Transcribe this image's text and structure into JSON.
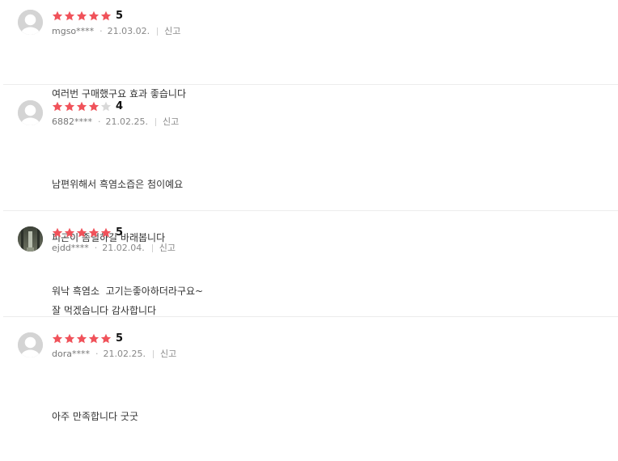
{
  "colors": {
    "star_filled": "#f0525a",
    "star_empty": "#d9d9d9",
    "meta_text": "#888888",
    "divider": "#ececec"
  },
  "reviews": [
    {
      "avatar": "default-avatar-icon",
      "rating": 5,
      "score_label": "5",
      "user": "mgso****",
      "date": "21.03.02.",
      "report_label": "신고",
      "lines": [
        "여러번 구매했구요 효과 좋습니다"
      ]
    },
    {
      "avatar": "default-avatar-icon",
      "rating": 4,
      "score_label": "4",
      "user": "6882****",
      "date": "21.02.25.",
      "report_label": "신고",
      "lines": [
        "남편위해서 흑염소즙은 첨이예요",
        "피곤이 좀덜하길 바래봅니다",
        "워낙 흑염소  고기는좋아하더라구요~"
      ]
    },
    {
      "avatar": "profile-photo",
      "rating": 5,
      "score_label": "5",
      "user": "ejdd****",
      "date": "21.02.04.",
      "report_label": "신고",
      "lines": [
        "잘 먹겠습니다 감사합니다"
      ]
    },
    {
      "avatar": "default-avatar-icon",
      "rating": 5,
      "score_label": "5",
      "user": "dora****",
      "date": "21.02.25.",
      "report_label": "신고",
      "lines": [
        "아주 만족합니다 굿굿"
      ]
    }
  ]
}
